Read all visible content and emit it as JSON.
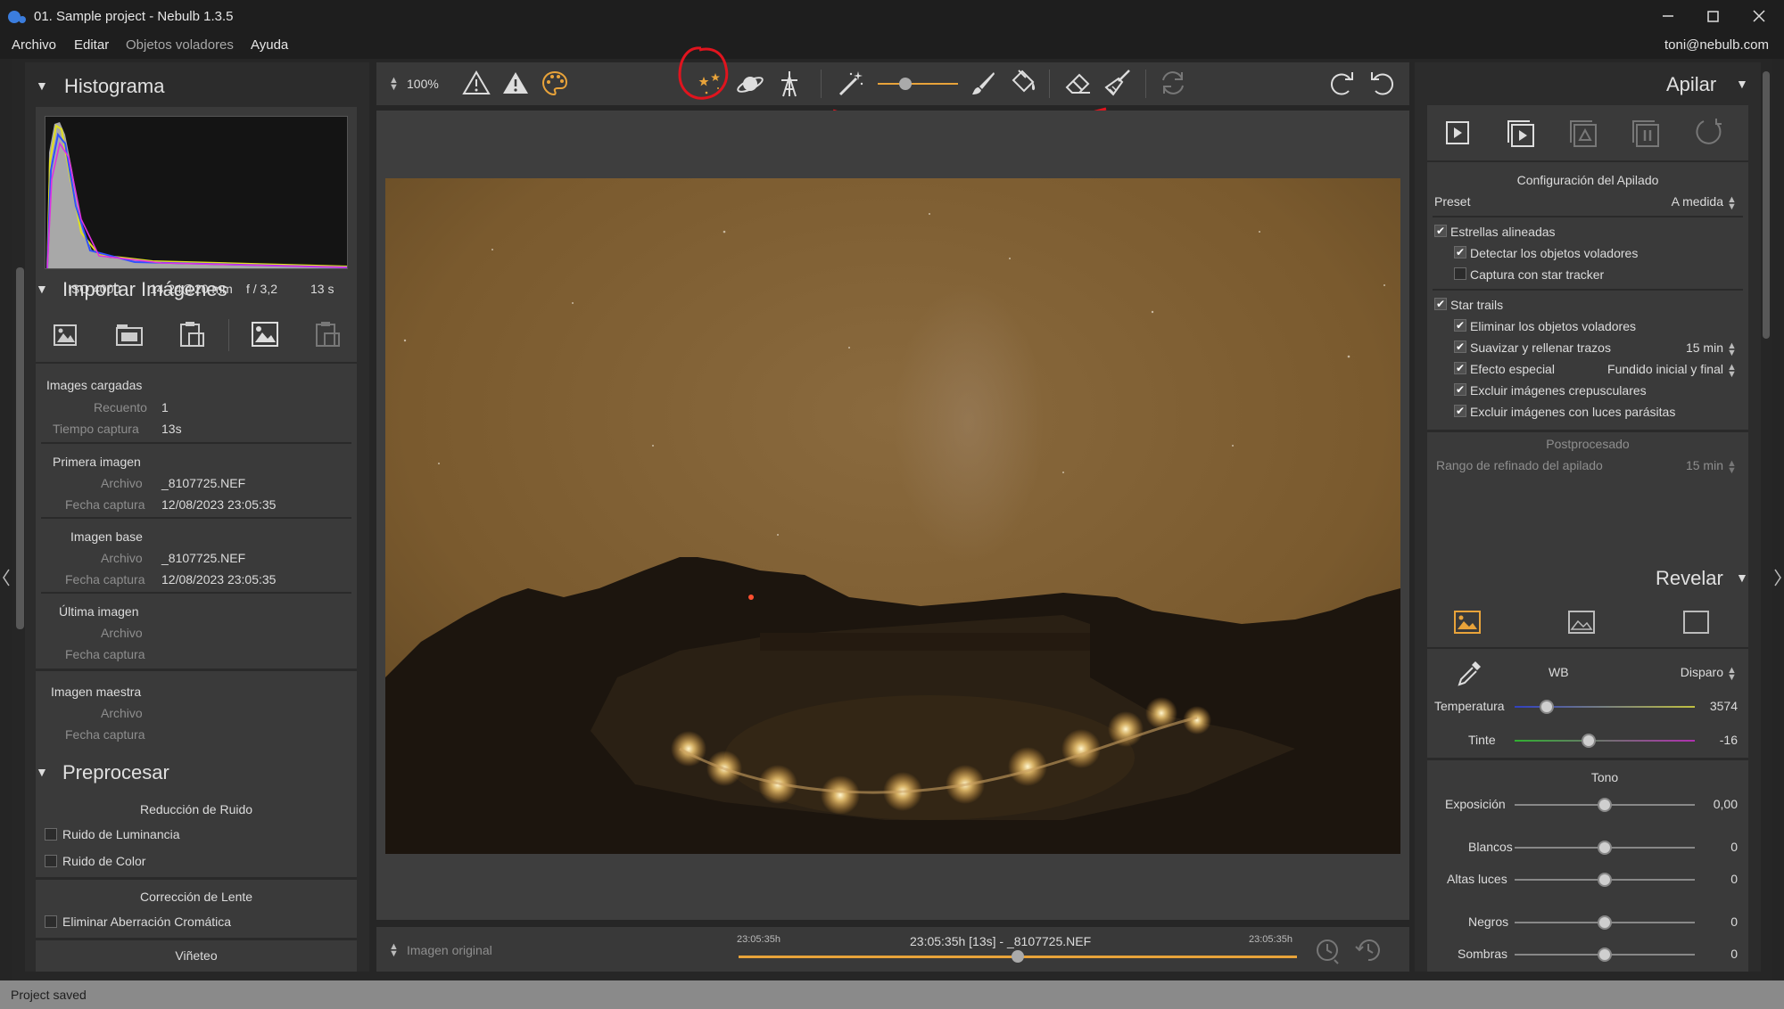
{
  "window": {
    "title": "01. Sample project - Nebulb 1.3.5"
  },
  "menu": {
    "items": [
      "Archivo",
      "Editar",
      "Objetos voladores",
      "Ayuda"
    ],
    "user": "toni@nebulb.com"
  },
  "histogram": {
    "title": "Histograma",
    "iso": "ISO 4000",
    "lens": "14-24@20 mm",
    "aperture": "f / 3,2",
    "exposure": "13 s"
  },
  "import": {
    "title": "Importar Imágenes",
    "loaded": {
      "heading": "Images cargadas",
      "count_label": "Recuento",
      "count": "1",
      "time_label": "Tiempo captura",
      "time": "13s"
    },
    "first": {
      "heading": "Primera imagen",
      "file_label": "Archivo",
      "file": "_8107725.NEF",
      "date_label": "Fecha captura",
      "date": "12/08/2023 23:05:35"
    },
    "base": {
      "heading": "Imagen base",
      "file_label": "Archivo",
      "file": "_8107725.NEF",
      "date_label": "Fecha captura",
      "date": "12/08/2023 23:05:35"
    },
    "last": {
      "heading": "Última imagen",
      "file_label": "Archivo",
      "date_label": "Fecha captura"
    },
    "master": {
      "heading": "Imagen maestra",
      "file_label": "Archivo",
      "date_label": "Fecha captura"
    }
  },
  "preprocess": {
    "title": "Preprocesar",
    "noise": {
      "heading": "Reducción de Ruido",
      "luminance": "Ruido de Luminancia",
      "color": "Ruido de Color"
    },
    "lens": {
      "heading": "Corrección de Lente",
      "chromatic": "Eliminar Aberración Cromática"
    },
    "vignette": "Viñeteo"
  },
  "toolbar": {
    "zoom": "100%"
  },
  "viewer": {
    "mode": "Imagen original",
    "time_left": "23:05:35h",
    "time_right": "23:05:35h",
    "frame_label": "23:05:35h [13s] - _8107725.NEF",
    "scrub_position": 0.5
  },
  "stack": {
    "title": "Apilar",
    "config_heading": "Configuración del Apilado",
    "preset_label": "Preset",
    "preset_value": "A medida",
    "aligned": {
      "label": "Estrellas alineadas",
      "checked": true
    },
    "detect": {
      "label": "Detectar los objetos voladores",
      "checked": true
    },
    "tracker": {
      "label": "Captura con star tracker",
      "checked": false
    },
    "trails": {
      "label": "Star trails",
      "checked": true
    },
    "remove": {
      "label": "Eliminar los objetos voladores",
      "checked": true
    },
    "smooth": {
      "label": "Suavizar y rellenar trazos",
      "checked": true,
      "value": "15 min"
    },
    "effect": {
      "label": "Efecto especial",
      "checked": true,
      "value": "Fundido inicial y final"
    },
    "twilight": {
      "label": "Excluir imágenes crepusculares",
      "checked": true
    },
    "parasitic": {
      "label": "Excluir imágenes con luces parásitas",
      "checked": true
    },
    "post_heading": "Postprocesado",
    "refine_label": "Rango de refinado del apilado",
    "refine_value": "15 min"
  },
  "develop": {
    "title": "Revelar",
    "wb_label": "WB",
    "wb_value": "Disparo",
    "temperature": {
      "label": "Temperatura",
      "value": "3574",
      "position": 0.18
    },
    "tint": {
      "label": "Tinte",
      "value": "-16",
      "position": 0.41
    },
    "tone_heading": "Tono",
    "exposure": {
      "label": "Exposición",
      "value": "0,00",
      "position": 0.5
    },
    "whites": {
      "label": "Blancos",
      "value": "0",
      "position": 0.5
    },
    "highlights": {
      "label": "Altas luces",
      "value": "0",
      "position": 0.5
    },
    "blacks": {
      "label": "Negros",
      "value": "0",
      "position": 0.5
    },
    "shadows": {
      "label": "Sombras",
      "value": "0",
      "position": 0.5
    }
  },
  "status": {
    "text": "Project saved"
  },
  "colors": {
    "accent": "#e8a33a",
    "annotation": "#e0141e"
  }
}
